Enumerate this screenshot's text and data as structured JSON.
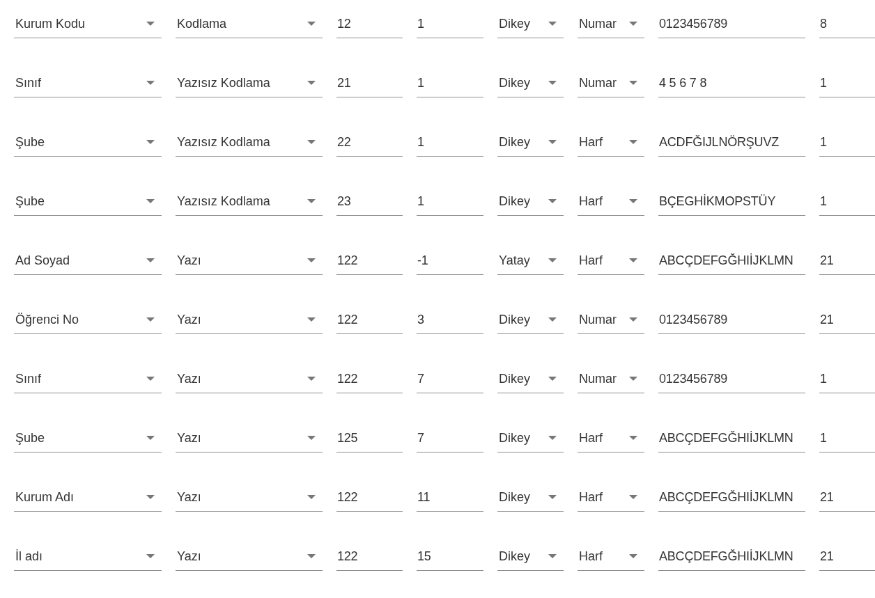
{
  "rows": [
    [
      {
        "kind": "select",
        "value": "Kurum Kodu"
      },
      {
        "kind": "select",
        "value": "Kodlama"
      },
      {
        "kind": "input",
        "value": "12"
      },
      {
        "kind": "input",
        "value": "1"
      },
      {
        "kind": "select",
        "value": "Dikey"
      },
      {
        "kind": "select",
        "value": "Numar"
      },
      {
        "kind": "input",
        "value": "0123456789"
      },
      {
        "kind": "input",
        "value": "8"
      }
    ],
    [
      {
        "kind": "select",
        "value": "Sınıf"
      },
      {
        "kind": "select",
        "value": "Yazısız Kodlama"
      },
      {
        "kind": "input",
        "value": "21"
      },
      {
        "kind": "input",
        "value": "1"
      },
      {
        "kind": "select",
        "value": "Dikey"
      },
      {
        "kind": "select",
        "value": "Numar"
      },
      {
        "kind": "input",
        "value": "4 5 6 7 8"
      },
      {
        "kind": "input",
        "value": "1"
      }
    ],
    [
      {
        "kind": "select",
        "value": "Şube"
      },
      {
        "kind": "select",
        "value": "Yazısız Kodlama"
      },
      {
        "kind": "input",
        "value": "22"
      },
      {
        "kind": "input",
        "value": "1"
      },
      {
        "kind": "select",
        "value": "Dikey"
      },
      {
        "kind": "select",
        "value": "Harf"
      },
      {
        "kind": "input",
        "value": "ACDFĞIJLNÖRŞUVZ"
      },
      {
        "kind": "input",
        "value": "1"
      }
    ],
    [
      {
        "kind": "select",
        "value": "Şube"
      },
      {
        "kind": "select",
        "value": "Yazısız Kodlama"
      },
      {
        "kind": "input",
        "value": "23"
      },
      {
        "kind": "input",
        "value": "1"
      },
      {
        "kind": "select",
        "value": "Dikey"
      },
      {
        "kind": "select",
        "value": "Harf"
      },
      {
        "kind": "input",
        "value": "BÇEGHİKMOPSTÜY"
      },
      {
        "kind": "input",
        "value": "1"
      }
    ],
    [
      {
        "kind": "select",
        "value": "Ad Soyad"
      },
      {
        "kind": "select",
        "value": "Yazı"
      },
      {
        "kind": "input",
        "value": "122"
      },
      {
        "kind": "input",
        "value": "-1"
      },
      {
        "kind": "select",
        "value": "Yatay"
      },
      {
        "kind": "select",
        "value": "Harf"
      },
      {
        "kind": "input",
        "value": "ABCÇDEFGĞHIİJKLMN"
      },
      {
        "kind": "input",
        "value": "21"
      }
    ],
    [
      {
        "kind": "select",
        "value": "Öğrenci No"
      },
      {
        "kind": "select",
        "value": "Yazı"
      },
      {
        "kind": "input",
        "value": "122"
      },
      {
        "kind": "input",
        "value": "3"
      },
      {
        "kind": "select",
        "value": "Dikey"
      },
      {
        "kind": "select",
        "value": "Numar"
      },
      {
        "kind": "input",
        "value": "0123456789"
      },
      {
        "kind": "input",
        "value": "21"
      }
    ],
    [
      {
        "kind": "select",
        "value": "Sınıf"
      },
      {
        "kind": "select",
        "value": "Yazı"
      },
      {
        "kind": "input",
        "value": "122"
      },
      {
        "kind": "input",
        "value": "7"
      },
      {
        "kind": "select",
        "value": "Dikey"
      },
      {
        "kind": "select",
        "value": "Numar"
      },
      {
        "kind": "input",
        "value": "0123456789"
      },
      {
        "kind": "input",
        "value": "1"
      }
    ],
    [
      {
        "kind": "select",
        "value": "Şube"
      },
      {
        "kind": "select",
        "value": "Yazı"
      },
      {
        "kind": "input",
        "value": "125"
      },
      {
        "kind": "input",
        "value": "7"
      },
      {
        "kind": "select",
        "value": "Dikey"
      },
      {
        "kind": "select",
        "value": "Harf"
      },
      {
        "kind": "input",
        "value": "ABCÇDEFGĞHIİJKLMN"
      },
      {
        "kind": "input",
        "value": "1"
      }
    ],
    [
      {
        "kind": "select",
        "value": "Kurum Adı"
      },
      {
        "kind": "select",
        "value": "Yazı"
      },
      {
        "kind": "input",
        "value": "122"
      },
      {
        "kind": "input",
        "value": "11"
      },
      {
        "kind": "select",
        "value": "Dikey"
      },
      {
        "kind": "select",
        "value": "Harf"
      },
      {
        "kind": "input",
        "value": "ABCÇDEFGĞHIİJKLMN"
      },
      {
        "kind": "input",
        "value": "21"
      }
    ],
    [
      {
        "kind": "select",
        "value": "İl adı"
      },
      {
        "kind": "select",
        "value": "Yazı"
      },
      {
        "kind": "input",
        "value": "122"
      },
      {
        "kind": "input",
        "value": "15"
      },
      {
        "kind": "select",
        "value": "Dikey"
      },
      {
        "kind": "select",
        "value": "Harf"
      },
      {
        "kind": "input",
        "value": "ABCÇDEFGĞHIİJKLMN"
      },
      {
        "kind": "input",
        "value": "21"
      }
    ]
  ]
}
